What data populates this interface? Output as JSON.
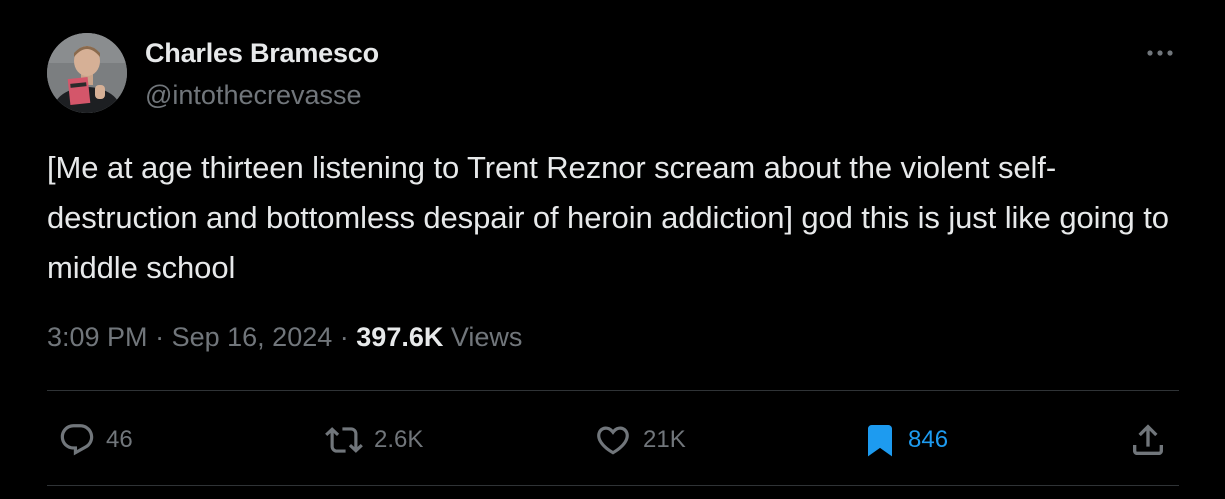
{
  "author": {
    "name": "Charles Bramesco",
    "handle": "@intothecrevasse"
  },
  "tweet": {
    "text": "[Me at age thirteen listening to Trent Reznor scream about the violent self-destruction and bottomless despair of heroin addiction] god this is just like going to middle school",
    "time": "3:09 PM",
    "separator": "·",
    "date": "Sep 16, 2024",
    "views_count": "397.6K",
    "views_label": "Views"
  },
  "actions": {
    "replies": "46",
    "reposts": "2.6K",
    "likes": "21K",
    "bookmarks": "846"
  },
  "icons": {
    "more": "more-horizontal-icon",
    "reply": "reply-bubble-icon",
    "repost": "repost-arrows-icon",
    "like": "heart-icon",
    "bookmark": "bookmark-filled-icon",
    "share": "share-upload-icon"
  },
  "colors": {
    "background": "#000000",
    "text_primary": "#e7e9ea",
    "text_secondary": "#71767b",
    "accent_blue": "#1d9bf0",
    "divider": "#2f3336"
  }
}
